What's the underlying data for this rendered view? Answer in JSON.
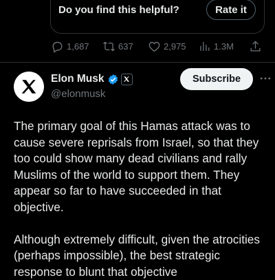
{
  "feedback": {
    "question": "Do you find this helpful?",
    "rate_button": "Rate it"
  },
  "actions": {
    "replies": "1,687",
    "reposts": "637",
    "likes": "2,975",
    "views": "1.3M"
  },
  "tweet": {
    "display_name": "Elon Musk",
    "handle": "@elonmusk",
    "subscribe_label": "Subscribe",
    "paragraphs": [
      "The primary goal of this Hamas attack was to cause severe reprisals from Israel, so that they too could show many dead civilians and rally Muslims of the world to support them. They appear so far to have succeeded in that objective.",
      "Although extremely difficult, given the atrocities (perhaps impossible), the best strategic response to blunt that objective"
    ]
  },
  "colors": {
    "background": "#000000",
    "text_primary": "#e7e9ea",
    "text_secondary": "#71767b",
    "verified_badge": "#1d9bf0",
    "border": "#2f3336"
  },
  "icons": [
    "reply-icon",
    "repost-icon",
    "like-icon",
    "views-icon",
    "share-icon",
    "x-logo-icon",
    "verified-badge-icon",
    "x-affiliate-icon",
    "more-options-icon"
  ]
}
